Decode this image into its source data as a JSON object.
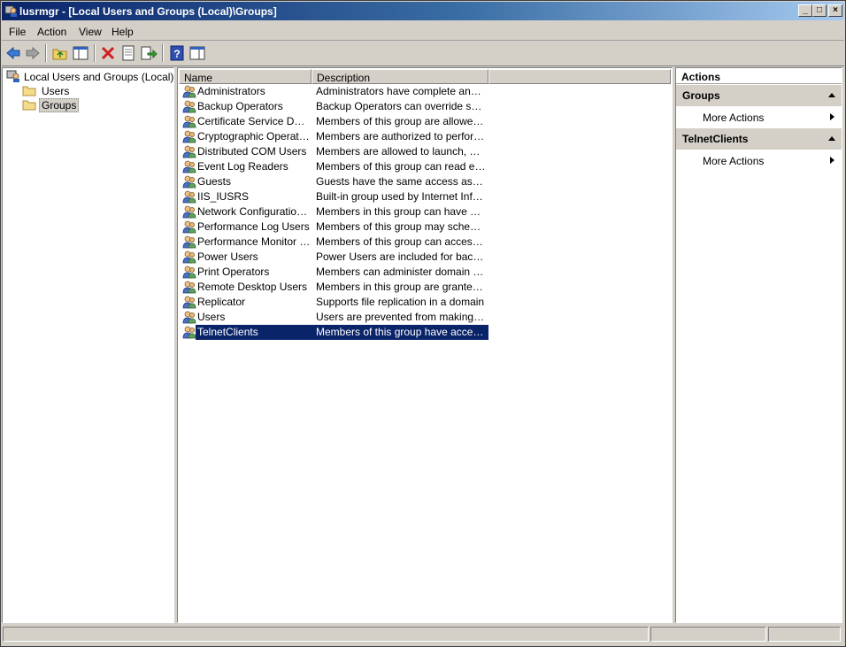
{
  "window": {
    "title": "lusrmgr - [Local Users and Groups (Local)\\Groups]"
  },
  "menu": [
    "File",
    "Action",
    "View",
    "Help"
  ],
  "tree": {
    "root": "Local Users and Groups (Local)",
    "children": [
      "Users",
      "Groups"
    ],
    "selected": "Groups"
  },
  "list": {
    "columns": {
      "name": "Name",
      "description": "Description"
    },
    "rows": [
      {
        "name": "Administrators",
        "description": "Administrators have complete and unrestricted access"
      },
      {
        "name": "Backup Operators",
        "description": "Backup Operators can override security restrictions"
      },
      {
        "name": "Certificate Service DCOM Access",
        "description": "Members of this group are allowed to connect"
      },
      {
        "name": "Cryptographic Operators",
        "description": "Members are authorized to perform cryptographic"
      },
      {
        "name": "Distributed COM Users",
        "description": "Members are allowed to launch, activate and use"
      },
      {
        "name": "Event Log Readers",
        "description": "Members of this group can read event logs"
      },
      {
        "name": "Guests",
        "description": "Guests have the same access as members of the Users"
      },
      {
        "name": "IIS_IUSRS",
        "description": "Built-in group used by Internet Information Services"
      },
      {
        "name": "Network Configuration Operators",
        "description": "Members in this group can have some administrative"
      },
      {
        "name": "Performance Log Users",
        "description": "Members of this group may schedule logging"
      },
      {
        "name": "Performance Monitor Users",
        "description": "Members of this group can access performance"
      },
      {
        "name": "Power Users",
        "description": "Power Users are included for backwards compatibility"
      },
      {
        "name": "Print Operators",
        "description": "Members can administer domain printers"
      },
      {
        "name": "Remote Desktop Users",
        "description": "Members in this group are granted the right"
      },
      {
        "name": "Replicator",
        "description": "Supports file replication in a domain"
      },
      {
        "name": "Users",
        "description": "Users are prevented from making accidental"
      },
      {
        "name": "TelnetClients",
        "description": "Members of this group have access to Telnet Server"
      }
    ],
    "selected_index": 16
  },
  "actions": {
    "header": "Actions",
    "sections": [
      {
        "title": "Groups",
        "items": [
          "More Actions"
        ]
      },
      {
        "title": "TelnetClients",
        "items": [
          "More Actions"
        ]
      }
    ]
  },
  "colors": {
    "title_start": "#0a246a",
    "title_end": "#a6caf0",
    "selection": "#0a246a",
    "chrome": "#d4d0c8"
  },
  "icons": [
    "app-icon",
    "back-icon",
    "forward-icon",
    "up-folder-icon",
    "show-hide-tree-icon",
    "delete-icon",
    "properties-icon",
    "export-icon",
    "help-icon",
    "show-hide-action-pane-icon",
    "folder-icon",
    "group-icon"
  ]
}
